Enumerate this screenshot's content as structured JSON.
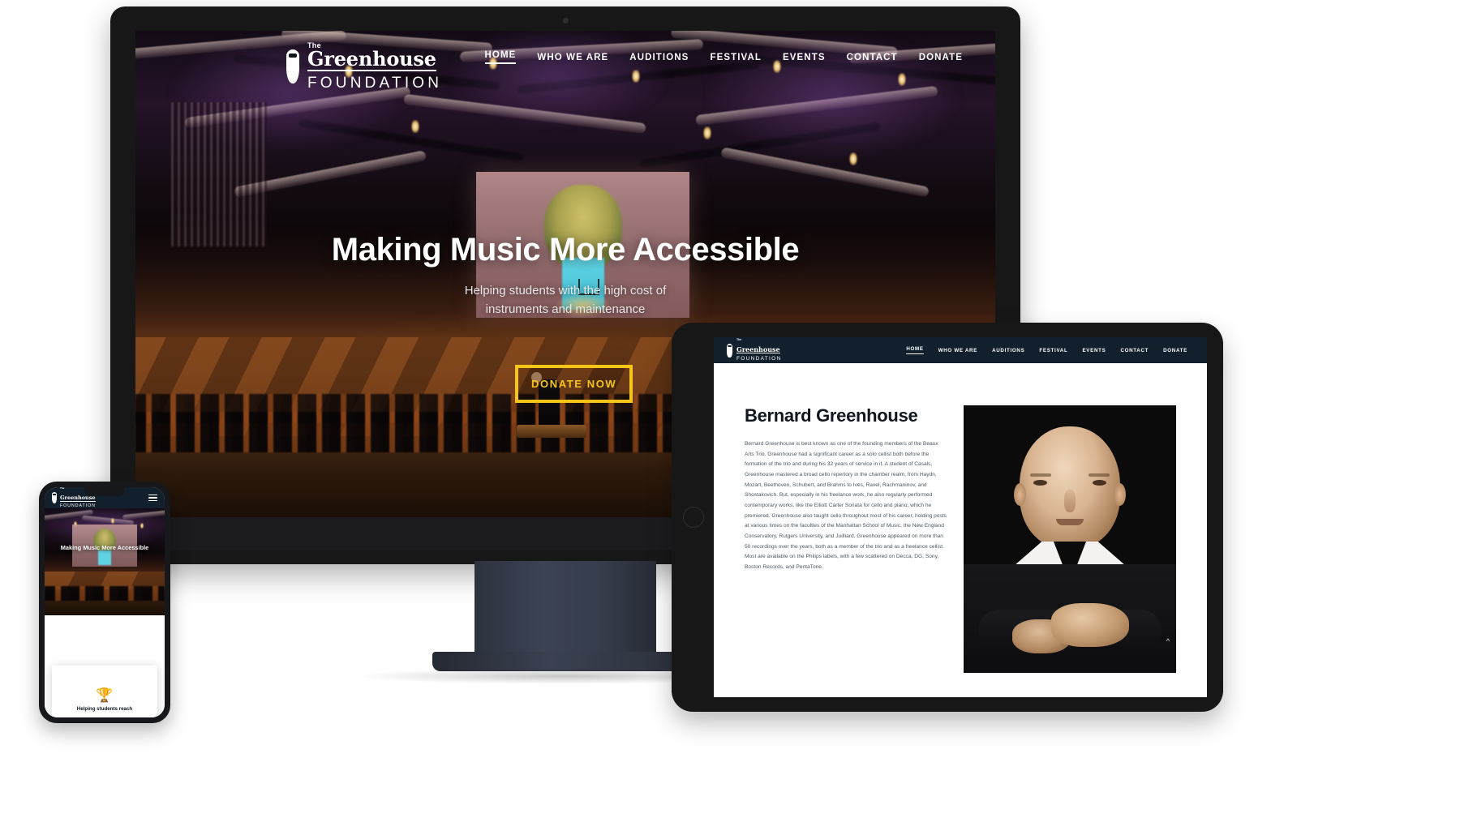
{
  "brand": {
    "the": "The",
    "name": "Greenhouse",
    "foundation": "FOUNDATION"
  },
  "desktop": {
    "nav": [
      {
        "label": "HOME",
        "active": true
      },
      {
        "label": "WHO WE ARE",
        "active": false
      },
      {
        "label": "AUDITIONS",
        "active": false
      },
      {
        "label": "FESTIVAL",
        "active": false
      },
      {
        "label": "EVENTS",
        "active": false
      },
      {
        "label": "CONTACT",
        "active": false
      },
      {
        "label": "DONATE",
        "active": false
      }
    ],
    "hero": {
      "title": "Making Music More Accessible",
      "subtitle": "Helping students with the high cost of instruments and maintenance",
      "cta": "DONATE NOW",
      "cta_color": "#f5c518"
    }
  },
  "tablet": {
    "nav": [
      {
        "label": "HOME",
        "active": true
      },
      {
        "label": "WHO WE ARE",
        "active": false
      },
      {
        "label": "AUDITIONS",
        "active": false
      },
      {
        "label": "FESTIVAL",
        "active": false
      },
      {
        "label": "EVENTS",
        "active": false
      },
      {
        "label": "CONTACT",
        "active": false
      },
      {
        "label": "DONATE",
        "active": false
      }
    ],
    "nav_background": "#11202c",
    "article": {
      "title": "Bernard Greenhouse",
      "body": "Bernard Greenhouse is best known as one of the founding members of the Beaux Arts Trio. Greenhouse had a significant career as a solo cellist both before the formation of the trio and during his 32 years of service in it. A student of Casals, Greenhouse mastered a broad cello repertory in the chamber realm, from Haydn, Mozart, Beethoven, Schubert, and Brahms to Ives, Ravel, Rachmaninov, and Shostakovich. But, especially in his freelance work, he also regularly performed contemporary works, like the Elliott Carter Sonata for cello and piano, which he premiered. Greenhouse also taught cello throughout most of his career, holding posts at various times on the faculties of the Manhattan School of Music, the New England Conservatory, Rutgers University, and Juilliard. Greenhouse appeared on more than 50 recordings over the years, both as a member of the trio and as a freelance cellist. Most are available on the Philips labels, with a few scattered on Decca, DG, Sony, Boston Records, and PentaTone.",
      "photo_alt": "Portrait of Bernard Greenhouse"
    }
  },
  "phone": {
    "menu_icon": "hamburger-menu-icon",
    "hero_title": "Making Music More Accessible",
    "card": {
      "icon": "trophy-icon",
      "glyph": "🏆",
      "text": "Helping students reach"
    }
  }
}
